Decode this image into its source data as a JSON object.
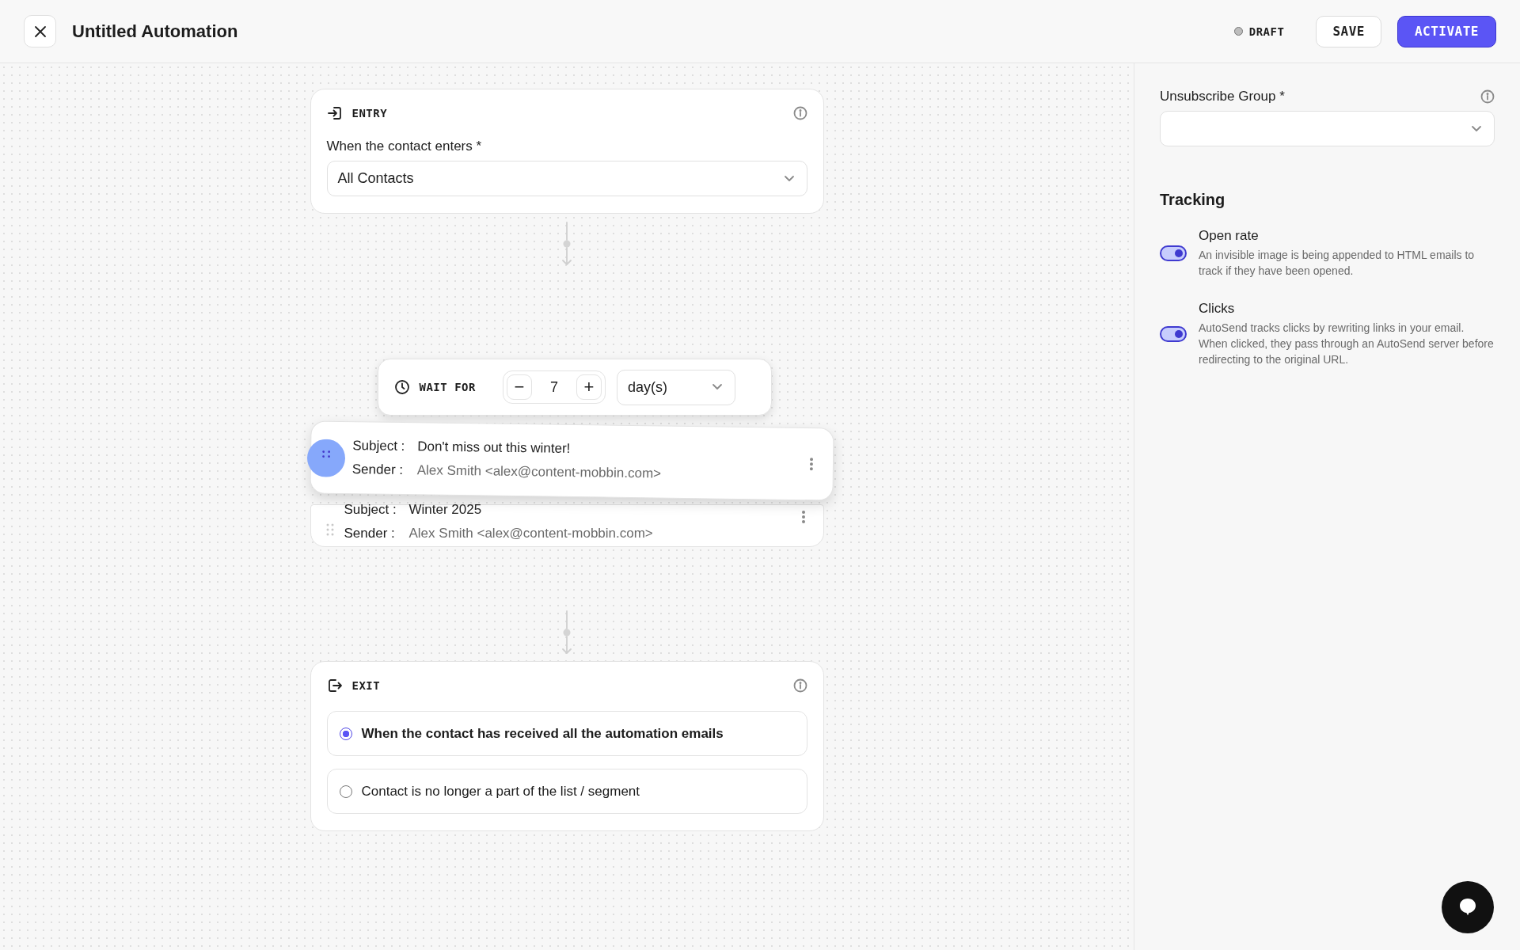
{
  "header": {
    "title": "Untitled Automation",
    "status": "DRAFT",
    "buttons": [
      {
        "label": "SAVE",
        "kind": "secondary"
      },
      {
        "label": "ACTIVATE",
        "kind": "primary"
      }
    ]
  },
  "entry": {
    "heading": "ENTRY",
    "field_label": "When the contact enters *",
    "value": "All Contacts"
  },
  "wait": {
    "heading": "WAIT FOR",
    "minus": "−",
    "amount": "7",
    "plus": "+",
    "unit": "day(s)"
  },
  "emails": [
    {
      "subject_label": "Subject :",
      "subject": "Don't miss out this winter!",
      "sender_label": "Sender :",
      "sender": "Alex Smith <alex@content-mobbin.com>",
      "dragging": true
    },
    {
      "subject_label": "Subject :",
      "subject": "Winter 2025",
      "sender_label": "Sender :",
      "sender": "Alex Smith <alex@content-mobbin.com>",
      "dragging": false
    }
  ],
  "exit": {
    "heading": "EXIT",
    "options": [
      {
        "label": "When the contact has received all the automation emails",
        "selected": true
      },
      {
        "label": "Contact is no longer a part of the list / segment",
        "selected": false
      }
    ]
  },
  "settings": {
    "unsubscribe_label": "Unsubscribe Group *",
    "tracking_heading": "Tracking",
    "toggles": [
      {
        "title": "Open rate",
        "description": "An invisible image is being appended to HTML emails to track if they have been opened.",
        "on": true
      },
      {
        "title": "Clicks",
        "description": "AutoSend tracks clicks by rewriting links in your email. When clicked, they pass through an AutoSend server before redirecting to the original URL.",
        "on": true
      }
    ]
  }
}
